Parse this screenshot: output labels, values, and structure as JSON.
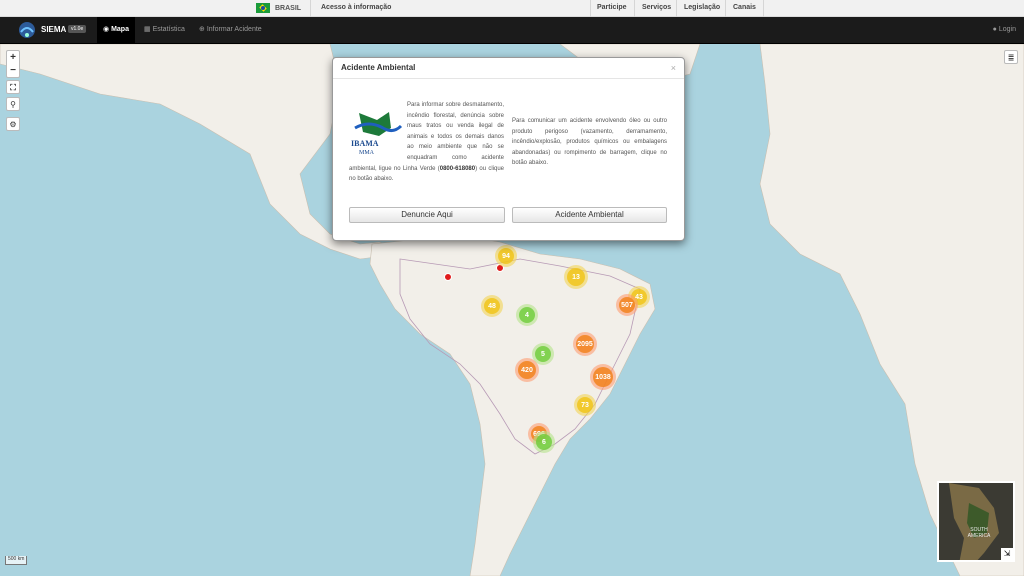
{
  "govbar": {
    "country": "BRASIL",
    "access": "Acesso à informação",
    "links": [
      "Participe",
      "Serviços",
      "Legislação",
      "Canais"
    ]
  },
  "navbar": {
    "brand": "SIEMA",
    "version": "v1.0e",
    "items": [
      "Mapa",
      "Estatística",
      "Informar Acidente"
    ],
    "login": "Login"
  },
  "map": {
    "scale": "500 km",
    "minimap_label": "SOUTH AMERICA",
    "clusters": [
      "94",
      "13",
      "43",
      "507",
      "48",
      "4",
      "2095",
      "5",
      "420",
      "1038",
      "73",
      "696",
      "6"
    ]
  },
  "modal": {
    "title": "Acidente Ambiental",
    "logo_top": "IBAMA",
    "logo_bottom": "MMA",
    "left_text": "Para informar sobre desmatamento, incêndio florestal, denúncia sobre maus tratos ou venda ilegal de animais e todos os demais danos ao meio ambiente que não se enquadram como acidente ambiental, ligue no Linha Verde (",
    "left_phone": "0800-618080",
    "left_text_end": ") ou clique no botão abaixo.",
    "right_text": "Para comunicar um acidente envolvendo óleo ou outro produto perigoso (vazamento, derramamento, incêndio/explosão, produtos químicos ou embalagens abandonadas) ou rompimento de barragem, clique no botão abaixo.",
    "btn_left": "Denuncie Aqui",
    "btn_right": "Acidente Ambiental"
  },
  "colors": {
    "cluster_small": "#6ecc39",
    "cluster_medium": "#f0c20c",
    "cluster_large": "#f18017"
  }
}
